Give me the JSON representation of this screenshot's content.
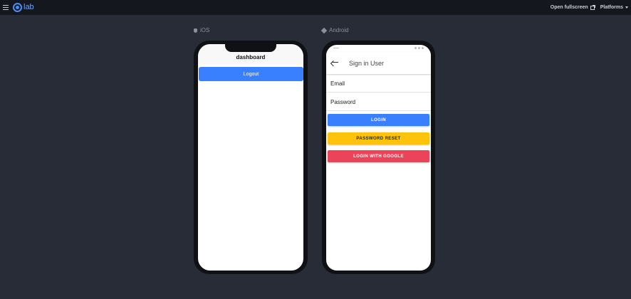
{
  "topbar": {
    "logo_text": "lab",
    "open_fullscreen": "Open fullscreen",
    "platforms": "Platforms",
    "icons": [
      "menu-icon",
      "external-link-icon",
      "chevron-down-icon"
    ]
  },
  "platforms": {
    "ios_label": "iOS",
    "android_label": "Android"
  },
  "ios": {
    "title": "dashboard",
    "logout_label": "Logout",
    "accent": "#3880ff"
  },
  "android": {
    "title": "Sign in User",
    "email_placeholder": "Email",
    "password_placeholder": "Password",
    "login_label": "LOGIN",
    "reset_label": "PASSWORD RESET",
    "google_label": "LOGIN WITH GOOGLE",
    "colors": {
      "login": "#3880ff",
      "reset": "#ffc409",
      "google": "#eb445a"
    }
  }
}
